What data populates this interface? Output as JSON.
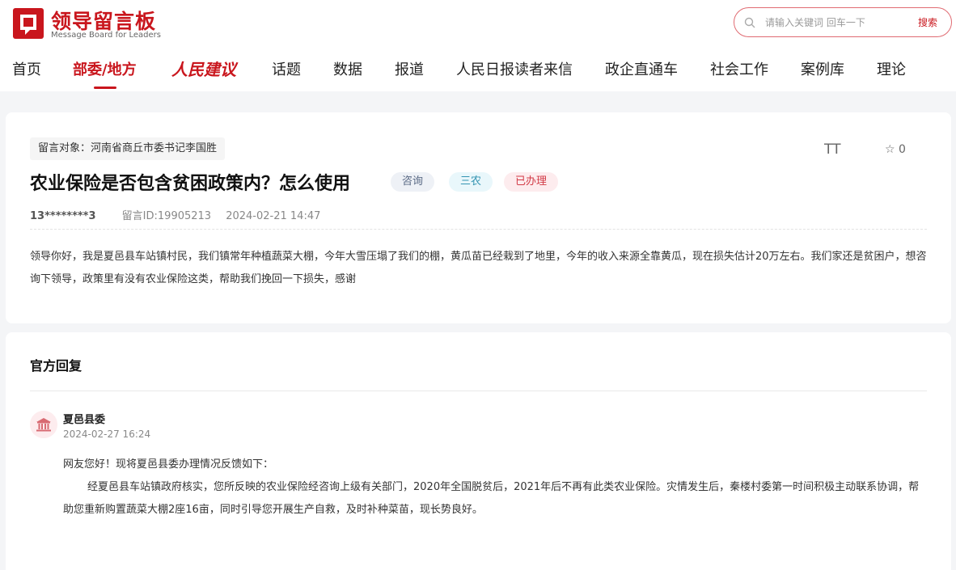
{
  "header": {
    "logo_title": "领导留言板",
    "logo_sub": "Message Board for Leaders",
    "search_placeholder": "请输入关键词 回车一下",
    "search_button": "搜索",
    "accent": "#c9161d"
  },
  "nav": {
    "items": [
      "首页",
      "部委/地方",
      "人民建议",
      "话题",
      "数据",
      "报道",
      "人民日报读者来信",
      "政企直通车",
      "社会工作",
      "案例库",
      "理论"
    ],
    "active": "部委/地方"
  },
  "message": {
    "target": "留言对象：河南省商丘市委书记李国胜",
    "title": "农业保险是否包含贫困政策内？怎么使用",
    "badges": [
      "咨询",
      "三农",
      "已办理"
    ],
    "user": "13********3",
    "message_id": "留言ID:19905213",
    "datetime": "2024-02-21 14:47",
    "font_tool": "TT",
    "favorites": "0",
    "content": "领导你好，我是夏邑县车站镇村民，我们镇常年种植蔬菜大棚，今年大雪压塌了我们的棚，黄瓜苗已经栽到了地里，今年的收入来源全靠黄瓜，现在损失估计20万左右。我们家还是贫困户，想咨询下领导，政策里有没有农业保险这类，帮助我们挽回一下损失，感谢"
  },
  "reply": {
    "heading": "官方回复",
    "org": "夏邑县委",
    "time": "2024-02-27 16:24",
    "greeting": "网友您好！现将夏邑县委办理情况反馈如下：",
    "body": "经夏邑县车站镇政府核实，您所反映的农业保险经咨询上级有关部门，2020年全国脱贫后，2021年后不再有此类农业保险。灾情发生后，秦楼村委第一时间积极主动联系协调，帮助您重新购置蔬菜大棚2座16亩，同时引导您开展生产自救，及时补种菜苗，现长势良好。"
  }
}
